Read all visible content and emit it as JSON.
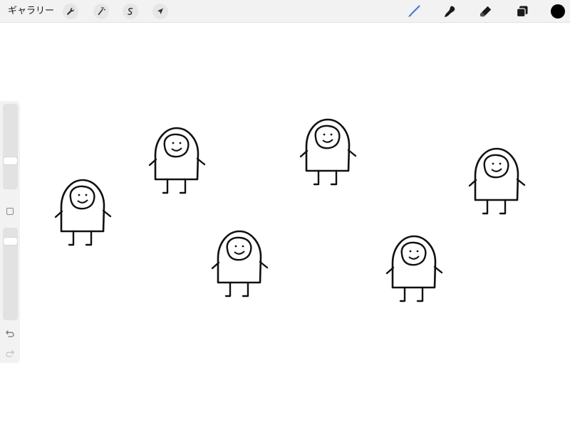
{
  "toolbar": {
    "gallery_label": "ギャラリー",
    "left_tools": [
      {
        "name": "actions",
        "icon": "wrench-icon"
      },
      {
        "name": "adjustments",
        "icon": "magic-wand-icon"
      },
      {
        "name": "selection",
        "icon": "selection-s-icon"
      },
      {
        "name": "transform",
        "icon": "arrow-cursor-icon"
      }
    ],
    "right_tools": [
      {
        "name": "brush",
        "icon": "brush-icon",
        "active": true
      },
      {
        "name": "smudge",
        "icon": "smudge-icon",
        "active": false
      },
      {
        "name": "eraser",
        "icon": "eraser-icon",
        "active": false
      },
      {
        "name": "layers",
        "icon": "layers-icon",
        "active": false
      }
    ],
    "current_color": "#000000",
    "active_tool_color": "#4a7bd0"
  },
  "sidebar": {
    "brush_size": 0.32,
    "opacity": 0.88,
    "undo_icon": "undo-icon",
    "redo_icon": "redo-icon",
    "modify_icon": "square-icon"
  },
  "canvas": {
    "background": "#ffffff",
    "stroke_color": "#111111",
    "figures": [
      {
        "id": 1
      },
      {
        "id": 2
      },
      {
        "id": 3
      },
      {
        "id": 4
      },
      {
        "id": 5
      },
      {
        "id": 6
      }
    ]
  }
}
